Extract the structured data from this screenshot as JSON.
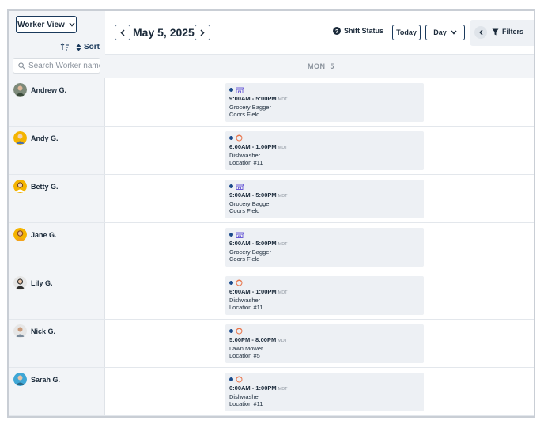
{
  "sidebar": {
    "view_button_label": "Worker View",
    "sort_label": "Sort",
    "search_placeholder": "Search Worker name"
  },
  "header": {
    "date_title": "May 5, 2025",
    "shift_status_label": "Shift Status",
    "today_label": "Today",
    "day_label": "Day",
    "filters_label": "Filters"
  },
  "day_column": {
    "label": "MON  5"
  },
  "colors": {
    "navy": "#1b3a5c",
    "status_dot": "#1b4a8a",
    "grocery_icon": "#6b5bd6",
    "dish_icon": "#e8744a"
  },
  "workers": [
    {
      "name": "Andrew G.",
      "avatar_bg": "#7d8a7a",
      "shift": {
        "icon": "storefront-icon",
        "start": "9:00AM",
        "end": "5:00PM",
        "tz": "MDT",
        "role": "Grocery Bagger",
        "location": "Coors Field"
      }
    },
    {
      "name": "Andy G.",
      "avatar_bg": "#f4b400",
      "shift": {
        "icon": "dish-icon",
        "start": "6:00AM",
        "end": "1:00PM",
        "tz": "MDT",
        "role": "Dishwasher",
        "location": "Location #11"
      }
    },
    {
      "name": "Betty G.",
      "avatar_bg": "#f4b400",
      "shift": {
        "icon": "storefront-icon",
        "start": "9:00AM",
        "end": "5:00PM",
        "tz": "MDT",
        "role": "Grocery Bagger",
        "location": "Coors Field"
      }
    },
    {
      "name": "Jane G.",
      "avatar_bg": "#f4b400",
      "shift": {
        "icon": "storefront-icon",
        "start": "9:00AM",
        "end": "5:00PM",
        "tz": "MDT",
        "role": "Grocery Bagger",
        "location": "Coors Field"
      }
    },
    {
      "name": "Lily G.",
      "avatar_bg": "#e6e6e6",
      "shift": {
        "icon": "dish-icon",
        "start": "6:00AM",
        "end": "1:00PM",
        "tz": "MDT",
        "role": "Dishwasher",
        "location": "Location #11"
      }
    },
    {
      "name": "Nick G.",
      "avatar_bg": "#e6e6e6",
      "shift": {
        "icon": "dish-icon",
        "start": "5:00PM",
        "end": "8:00PM",
        "tz": "MDT",
        "role": "Lawn Mower",
        "location": "Location #5"
      }
    },
    {
      "name": "Sarah G.",
      "avatar_bg": "#3fa7d6",
      "shift": {
        "icon": "dish-icon",
        "start": "6:00AM",
        "end": "1:00PM",
        "tz": "MDT",
        "role": "Dishwasher",
        "location": "Location #11"
      }
    }
  ]
}
